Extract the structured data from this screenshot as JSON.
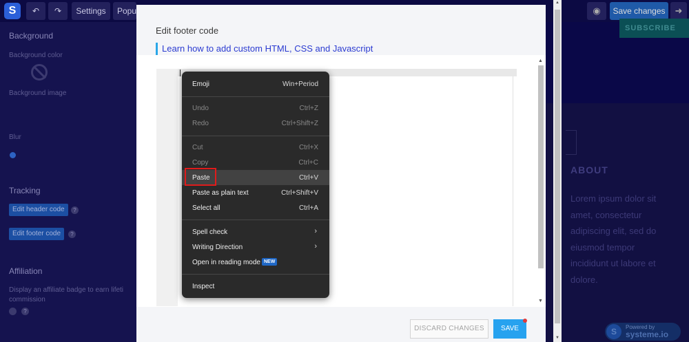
{
  "topbar": {
    "logo": "S",
    "undo_icon": "undo-icon",
    "redo_icon": "redo-icon",
    "settings_label": "Settings",
    "popup_label": "Popu",
    "preview_icon": "eye-icon",
    "save_changes_label": "Save changes",
    "exit_icon": "exit-icon"
  },
  "sidebar": {
    "background_heading": "Background",
    "background_color_label": "Background color",
    "background_image_label": "Background image",
    "blur_label": "Blur",
    "tracking_heading": "Tracking",
    "edit_header_code": "Edit header code",
    "edit_footer_code": "Edit footer code",
    "affiliation_heading": "Affiliation",
    "affiliation_text_1": "Display an affiliate badge to earn lifeti",
    "affiliation_text_2": "commission"
  },
  "preview": {
    "subscribe_label": "SUBSCRIBE",
    "about_heading": "ABOUT",
    "lorem_lines": [
      "Lorem ipsum dolor sit",
      "amet, consectetur",
      "adipiscing elit, sed do",
      "eiusmod tempor",
      "incididunt ut labore et",
      "dolore."
    ],
    "powered_small": "Powered by",
    "powered_name": "systeme.io"
  },
  "modal": {
    "title": "Edit footer code",
    "learn_link": "Learn how to add custom HTML, CSS and Javascript",
    "discard_label": "DISCARD CHANGES",
    "save_label": "SAVE"
  },
  "context_menu": {
    "emoji": {
      "label": "Emoji",
      "shortcut": "Win+Period"
    },
    "undo": {
      "label": "Undo",
      "shortcut": "Ctrl+Z"
    },
    "redo": {
      "label": "Redo",
      "shortcut": "Ctrl+Shift+Z"
    },
    "cut": {
      "label": "Cut",
      "shortcut": "Ctrl+X"
    },
    "copy": {
      "label": "Copy",
      "shortcut": "Ctrl+C"
    },
    "paste": {
      "label": "Paste",
      "shortcut": "Ctrl+V"
    },
    "paste_plain": {
      "label": "Paste as plain text",
      "shortcut": "Ctrl+Shift+V"
    },
    "select_all": {
      "label": "Select all",
      "shortcut": "Ctrl+A"
    },
    "spell_check": {
      "label": "Spell check"
    },
    "writing_direction": {
      "label": "Writing Direction"
    },
    "reading_mode": {
      "label": "Open in reading mode",
      "badge": "NEW"
    },
    "inspect": {
      "label": "Inspect"
    }
  },
  "colors": {
    "accent": "#27a2ef",
    "link": "#2b3bd1",
    "highlight_outline": "#e01b1b",
    "menu_bg": "#2a2a2a"
  }
}
